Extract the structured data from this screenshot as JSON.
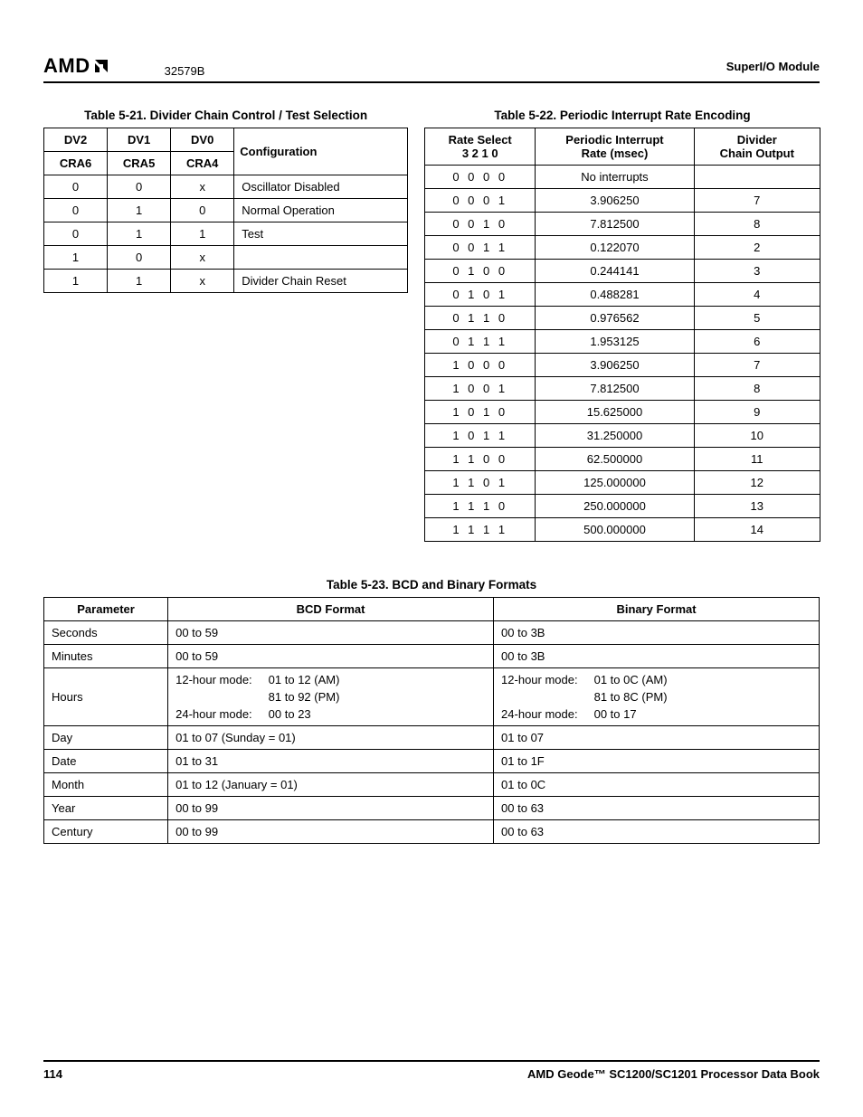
{
  "header": {
    "logo_text": "AMD",
    "doc_number": "32579B",
    "section": "SuperI/O Module"
  },
  "table521": {
    "caption": "Table 5-21.  Divider Chain Control / Test Selection",
    "head_r1": [
      "DV2",
      "DV1",
      "DV0"
    ],
    "head_r2": [
      "CRA6",
      "CRA5",
      "CRA4",
      "Configuration"
    ],
    "rows": [
      [
        "0",
        "0",
        "x",
        "Oscillator Disabled"
      ],
      [
        "0",
        "1",
        "0",
        "Normal Operation"
      ],
      [
        "0",
        "1",
        "1",
        "Test"
      ],
      [
        "1",
        "0",
        "x",
        ""
      ],
      [
        "1",
        "1",
        "x",
        "Divider Chain Reset"
      ]
    ]
  },
  "table522": {
    "caption": "Table 5-22.  Periodic Interrupt Rate Encoding",
    "head": {
      "c1a": "Rate Select",
      "c1b": "3 2 1 0",
      "c2a": "Periodic Interrupt",
      "c2b": "Rate (msec)",
      "c3a": "Divider",
      "c3b": "Chain Output"
    },
    "rows": [
      [
        "0 0 0 0",
        "No interrupts",
        ""
      ],
      [
        "0 0 0 1",
        "3.906250",
        "7"
      ],
      [
        "0 0 1 0",
        "7.812500",
        "8"
      ],
      [
        "0 0 1 1",
        "0.122070",
        "2"
      ],
      [
        "0 1 0 0",
        "0.244141",
        "3"
      ],
      [
        "0 1 0 1",
        "0.488281",
        "4"
      ],
      [
        "0 1 1 0",
        "0.976562",
        "5"
      ],
      [
        "0 1 1 1",
        "1.953125",
        "6"
      ],
      [
        "1 0 0 0",
        "3.906250",
        "7"
      ],
      [
        "1 0 0 1",
        "7.812500",
        "8"
      ],
      [
        "1 0 1 0",
        "15.625000",
        "9"
      ],
      [
        "1 0 1 1",
        "31.250000",
        "10"
      ],
      [
        "1 1 0 0",
        "62.500000",
        "11"
      ],
      [
        "1 1 0 1",
        "125.000000",
        "12"
      ],
      [
        "1 1 1 0",
        "250.000000",
        "13"
      ],
      [
        "1 1 1 1",
        "500.000000",
        "14"
      ]
    ]
  },
  "table523": {
    "caption": "Table 5-23.  BCD and Binary Formats",
    "head": [
      "Parameter",
      "BCD Format",
      "Binary Format"
    ],
    "rows": [
      {
        "param": "Seconds",
        "bcd": "00 to 59",
        "bin": "00 to 3B"
      },
      {
        "param": "Minutes",
        "bcd": "00 to 59",
        "bin": "00 to 3B"
      },
      {
        "param": "Hours",
        "bcd_multi": [
          [
            "12-hour mode:",
            "01 to 12 (AM)"
          ],
          [
            "",
            "81 to 92 (PM)"
          ],
          [
            "24-hour mode:",
            "00 to 23"
          ]
        ],
        "bin_multi": [
          [
            "12-hour mode:",
            "01 to 0C (AM)"
          ],
          [
            "",
            "81 to 8C (PM)"
          ],
          [
            "24-hour mode:",
            "00 to 17"
          ]
        ]
      },
      {
        "param": "Day",
        "bcd": "01 to 07 (Sunday = 01)",
        "bin": "01 to 07"
      },
      {
        "param": "Date",
        "bcd": "01 to 31",
        "bin": "01 to 1F"
      },
      {
        "param": "Month",
        "bcd": "01 to 12 (January = 01)",
        "bin": "01 to 0C"
      },
      {
        "param": "Year",
        "bcd": "00 to 99",
        "bin": "00 to 63"
      },
      {
        "param": "Century",
        "bcd": "00 to 99",
        "bin": "00 to 63"
      }
    ]
  },
  "footer": {
    "page": "114",
    "book": "AMD Geode™ SC1200/SC1201 Processor Data Book"
  }
}
